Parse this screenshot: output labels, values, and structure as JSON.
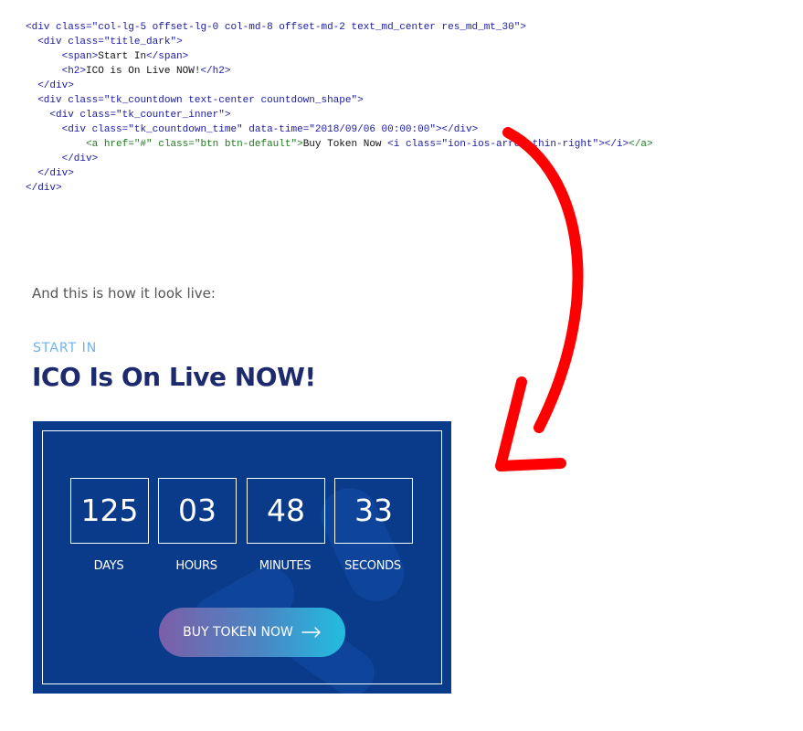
{
  "code_lines": [
    "<div class=\"col-lg-5 offset-lg-0 col-md-8 offset-md-2 text_md_center res_md_mt_30\">",
    "  <div class=\"title_dark\">",
    "      <span>Start In</span>",
    "      <h2>ICO is On Live NOW!</h2>",
    "  </div>",
    "  <div class=\"tk_countdown text-center countdown_shape\">",
    "    <div class=\"tk_counter_inner\">",
    "      <div class=\"tk_countdown_time\" data-time=\"2018/09/06 00:00:00\"></div>",
    "          <a href=\"#\" class=\"btn btn-default\">Buy Token Now <i class=\"ion-ios-arrow-thin-right\"></i></a>",
    "      </div>",
    "  </div>",
    "</div>"
  ],
  "caption": "And this is how it look live:",
  "preview": {
    "subtitle": "START IN",
    "title": "ICO Is On Live NOW!",
    "countdown": [
      {
        "value": "125",
        "label": "DAYS"
      },
      {
        "value": "03",
        "label": "HOURS"
      },
      {
        "value": "48",
        "label": "MINUTES"
      },
      {
        "value": "33",
        "label": "SECONDS"
      }
    ],
    "button_label": "BUY TOKEN NOW",
    "button_icon": "arrow-right-icon"
  },
  "annotation_icon": "hand-drawn-red-arrow",
  "colors": {
    "subtitle": "#6fb1ee",
    "title": "#1d2b6e",
    "panel_bg": "#0a3b8a",
    "arrow": "#ff0000",
    "button_gradient": [
      "#7b5fa8",
      "#22bde0"
    ]
  }
}
